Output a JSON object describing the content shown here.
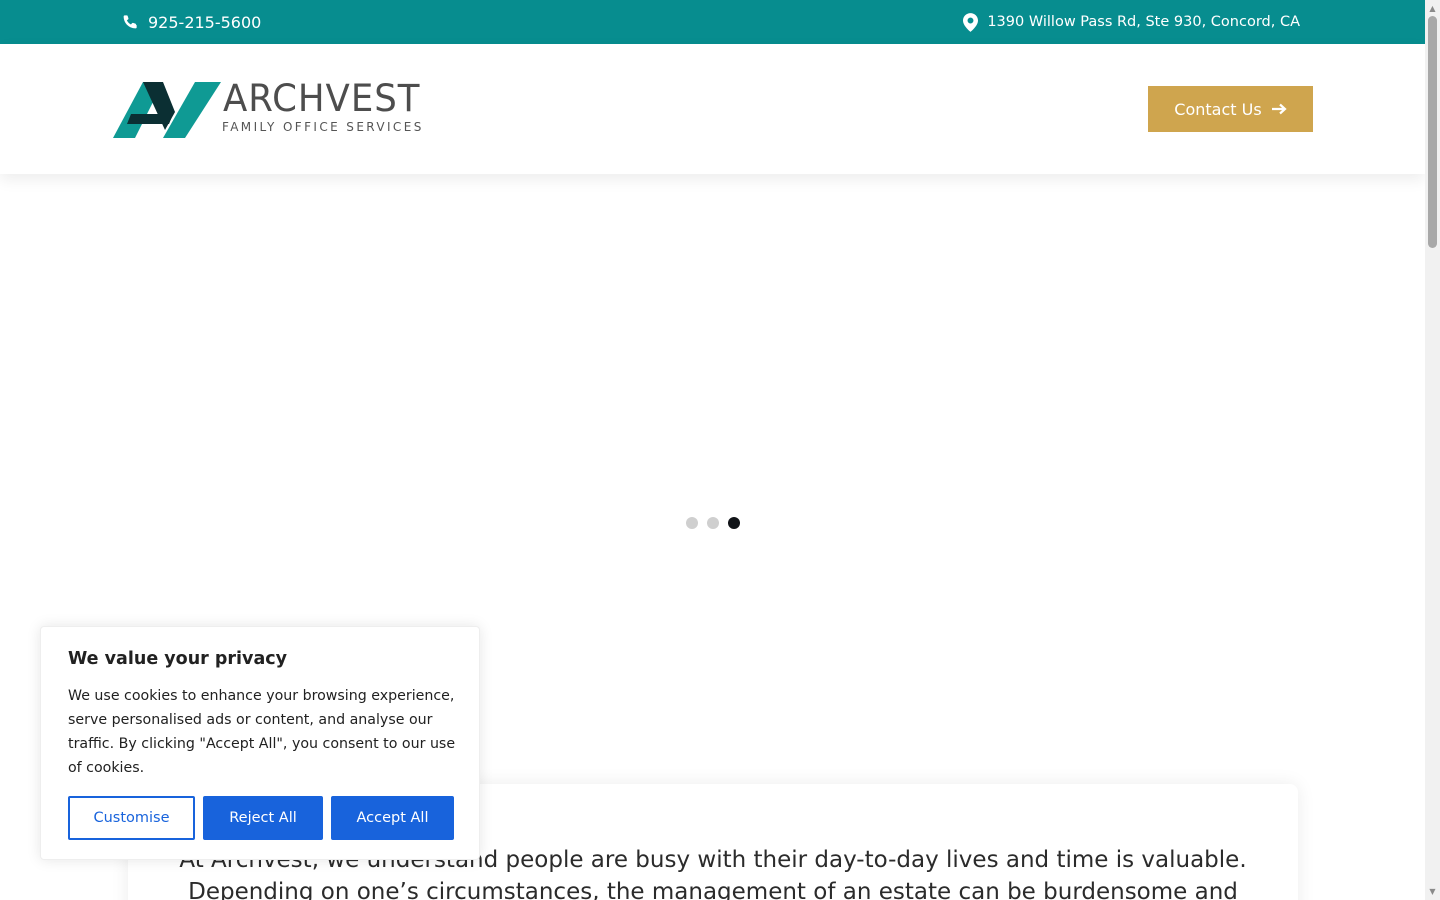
{
  "topbar": {
    "phone": "925-215-5600",
    "address": "1390 Willow Pass Rd, Ste 930, Concord, CA",
    "phone_icon": "phone-icon",
    "location_icon": "map-marker-icon"
  },
  "header": {
    "logo_name": "ARCHVEST",
    "logo_tagline": "FAMILY OFFICE SERVICES",
    "contact_label": "Contact Us",
    "contact_icon": "arrow-right-icon"
  },
  "slider": {
    "dot_count": 3,
    "active_index": 2
  },
  "content": {
    "intro": "At Archvest, we understand people are busy with their day-to-day lives and time is valuable. Depending on one’s circumstances, the management of an estate can be burdensome and"
  },
  "cookie_banner": {
    "title": "We value your privacy",
    "message": "We use cookies to enhance your browsing experience, serve personalised ads or content, and analyse our traffic. By clicking \"Accept All\", you consent to our use of cookies.",
    "customise_label": "Customise",
    "reject_label": "Reject All",
    "accept_label": "Accept All"
  },
  "colors": {
    "topbar_bg": "#078d8f",
    "accent_gold": "#cfa54e",
    "cookie_blue": "#1863dc",
    "logo_teal": "#0f9a94",
    "logo_dark": "#0b2f33"
  }
}
